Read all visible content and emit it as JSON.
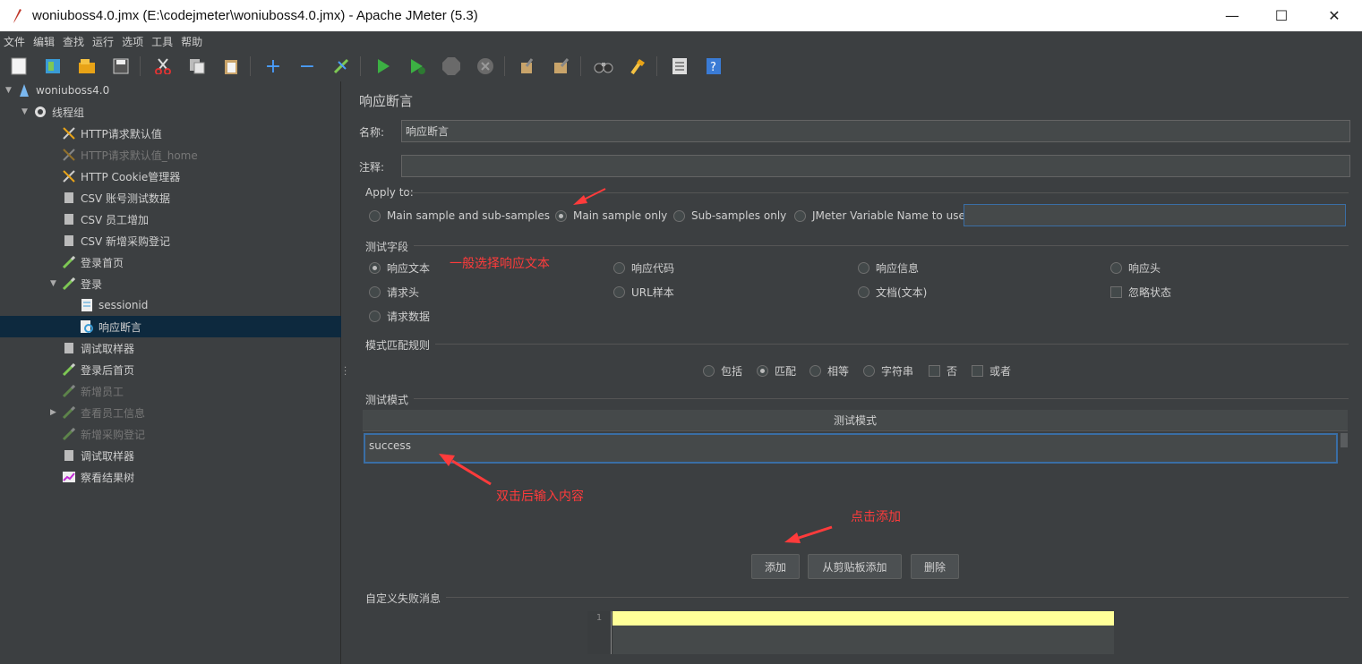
{
  "window": {
    "title": "woniuboss4.0.jmx (E:\\codejmeter\\woniuboss4.0.jmx) - Apache JMeter (5.3)",
    "minimize": "—",
    "maximize": "☐",
    "close": "✕"
  },
  "menu": [
    "文件",
    "编辑",
    "查找",
    "运行",
    "选项",
    "工具",
    "帮助"
  ],
  "toolbar": [
    "new-icon",
    "templates-icon",
    "open-icon",
    "save-icon",
    "cut-icon",
    "copy-icon",
    "paste-icon",
    "expand-icon",
    "collapse-icon",
    "toggle-icon",
    "start-icon",
    "start-no-pause-icon",
    "stop-icon",
    "shutdown-icon",
    "clear-icon",
    "clear-all-icon",
    "search-icon",
    "reset-search-icon",
    "function-helper-icon",
    "help-icon"
  ],
  "tree": [
    {
      "label": "woniuboss4.0",
      "level": 0,
      "arrow": "▼",
      "icon": "test-plan-icon",
      "state": "normal"
    },
    {
      "label": "线程组",
      "level": 1,
      "arrow": "▼",
      "icon": "gear-icon",
      "state": "normal"
    },
    {
      "label": "HTTP请求默认值",
      "level": 2,
      "arrow": "",
      "icon": "wrench-icon",
      "state": "normal"
    },
    {
      "label": "HTTP请求默认值_home",
      "level": 2,
      "arrow": "",
      "icon": "wrench-icon",
      "state": "disabled"
    },
    {
      "label": "HTTP Cookie管理器",
      "level": 2,
      "arrow": "",
      "icon": "wrench-icon",
      "state": "normal"
    },
    {
      "label": "CSV 账号测试数据",
      "level": 2,
      "arrow": "",
      "icon": "file-icon",
      "state": "normal"
    },
    {
      "label": "CSV 员工增加",
      "level": 2,
      "arrow": "",
      "icon": "file-icon",
      "state": "normal"
    },
    {
      "label": "CSV 新增采购登记",
      "level": 2,
      "arrow": "",
      "icon": "file-icon",
      "state": "normal"
    },
    {
      "label": "登录首页",
      "level": 2,
      "arrow": "",
      "icon": "pipette-icon",
      "state": "normal"
    },
    {
      "label": "登录",
      "level": 2,
      "arrow": "▼",
      "icon": "pipette-icon",
      "state": "normal"
    },
    {
      "label": "sessionid",
      "level": 3,
      "arrow": "",
      "icon": "extractor-icon",
      "state": "normal"
    },
    {
      "label": "响应断言",
      "level": 3,
      "arrow": "",
      "icon": "assertion-icon",
      "state": "selected"
    },
    {
      "label": "调试取样器",
      "level": 2,
      "arrow": "",
      "icon": "file-icon",
      "state": "normal"
    },
    {
      "label": "登录后首页",
      "level": 2,
      "arrow": "",
      "icon": "pipette-icon",
      "state": "normal"
    },
    {
      "label": "新增员工",
      "level": 2,
      "arrow": "",
      "icon": "pipette-icon",
      "state": "disabled"
    },
    {
      "label": "查看员工信息",
      "level": 2,
      "arrow": "▶",
      "icon": "pipette-icon",
      "state": "disabled"
    },
    {
      "label": "新增采购登记",
      "level": 2,
      "arrow": "",
      "icon": "pipette-icon",
      "state": "disabled"
    },
    {
      "label": "调试取样器",
      "level": 2,
      "arrow": "",
      "icon": "file-icon",
      "state": "normal"
    },
    {
      "label": "察看结果树",
      "level": 2,
      "arrow": "",
      "icon": "chart-icon",
      "state": "normal"
    }
  ],
  "panel": {
    "heading": "响应断言",
    "name_label": "名称:",
    "name_value": "响应断言",
    "comment_label": "注释:",
    "comment_value": "",
    "apply_to": {
      "legend": "Apply to:",
      "options": [
        "Main sample and sub-samples",
        "Main sample only",
        "Sub-samples only",
        "JMeter Variable Name to use"
      ],
      "selected": "Main sample only",
      "variable_value": ""
    },
    "test_field": {
      "legend": "测试字段",
      "options": [
        "响应文本",
        "响应代码",
        "响应信息",
        "响应头",
        "请求头",
        "URL样本",
        "文档(文本)",
        "请求数据"
      ],
      "checkbox": "忽略状态",
      "selected": "响应文本"
    },
    "match_rule": {
      "legend": "模式匹配规则",
      "radios": [
        "包括",
        "匹配",
        "相等",
        "字符串"
      ],
      "checks": [
        "否",
        "或者"
      ],
      "selected": "匹配"
    },
    "patterns": {
      "legend": "测试模式",
      "column_header": "测试模式",
      "rows": [
        "success"
      ]
    },
    "buttons": {
      "add": "添加",
      "add_clipboard": "从剪贴板添加",
      "delete": "删除"
    },
    "failure": {
      "legend": "自定义失败消息",
      "line_no": "1"
    }
  },
  "annotations": {
    "general": "一般选择响应文本",
    "dblclick": "双击后输入内容",
    "click_add": "点击添加"
  },
  "colors": {
    "annotation": "#ff3b3b",
    "selected_row": "#0d293e",
    "highlight_line": "#ffff99"
  }
}
